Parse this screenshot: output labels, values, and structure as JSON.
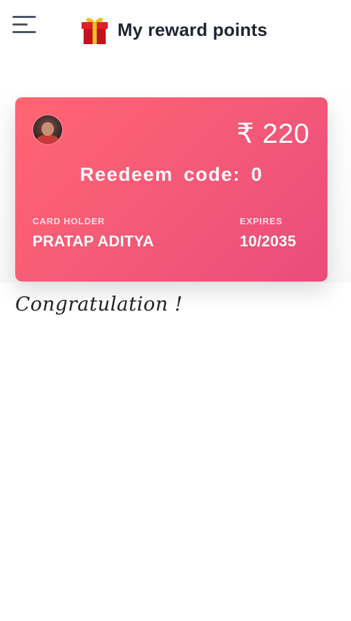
{
  "header": {
    "title": "My reward points",
    "menu_icon": "hamburger-menu-icon",
    "title_icon": "gift-icon"
  },
  "card": {
    "points": "₹ 220",
    "redeem_text": "Reedeem code: 0",
    "holder_label": "CARD HOLDER",
    "holder_name": "PRATAP ADITYA",
    "expires_label": "EXPIRES",
    "expires_value": "10/2035",
    "gradient_start": "#ff6572",
    "gradient_end": "#ea4c7b"
  },
  "message": "Congratulation !"
}
